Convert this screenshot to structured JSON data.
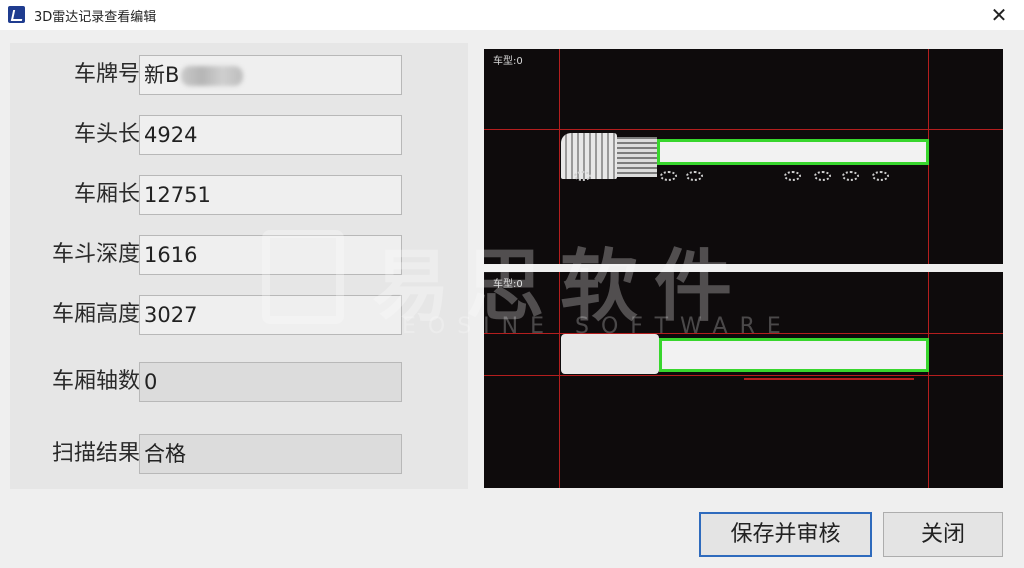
{
  "window": {
    "title": "3D雷达记录查看编辑"
  },
  "form": {
    "plate": {
      "label": "车牌号",
      "value": "新B"
    },
    "head_length": {
      "label": "车头长",
      "value": "4924"
    },
    "body_length": {
      "label": "车厢长",
      "value": "12751"
    },
    "bucket_depth": {
      "label": "车斗深度",
      "value": "1616"
    },
    "body_height": {
      "label": "车厢高度",
      "value": "3027"
    },
    "axle_count": {
      "label": "车厢轴数",
      "value": "0"
    },
    "scan_result": {
      "label": "扫描结果",
      "value": "合格"
    }
  },
  "views": {
    "top_label": "车型:0",
    "bottom_label": "车型:0"
  },
  "watermark": {
    "text": "易思软件",
    "sub": "EOSINE SOFTWARE"
  },
  "buttons": {
    "save": "保存并审核",
    "close": "关闭"
  },
  "colors": {
    "box_outline": "#38d62d",
    "grid_line": "#b41e1e",
    "view_bg": "#0e0b0c",
    "primary_border": "#2f6bbd"
  }
}
